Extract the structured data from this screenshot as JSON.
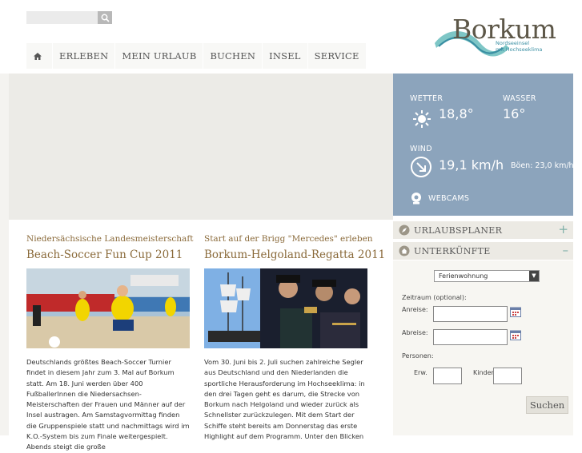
{
  "search": {
    "placeholder": ""
  },
  "nav": {
    "items": [
      {
        "label": "ERLEBEN"
      },
      {
        "label": "MEIN URLAUB"
      },
      {
        "label": "BUCHEN"
      },
      {
        "label": "INSEL"
      },
      {
        "label": "SERVICE"
      }
    ]
  },
  "logo": {
    "word": "Borkum",
    "sub1": "Nordseeinsel",
    "sub2": "mit Hochseeklima"
  },
  "weather": {
    "wetter_label": "WETTER",
    "wetter_value": "18,8°",
    "wasser_label": "WASSER",
    "wasser_value": "16°",
    "wind_label": "WIND",
    "wind_value": "19,1 km/h",
    "gusts": "Böen: 23,0 km/h",
    "webcams": "WEBCAMS"
  },
  "sidebar": {
    "urlaubsplaner": "URLAUBSPLANER",
    "unterkuenfte": "UNTERKÜNFTE",
    "type_select": "Ferienwohnung",
    "zeitraum": "Zeitraum (optional):",
    "anreise": "Anreise:",
    "abreise": "Abreise:",
    "personen": "Personen:",
    "erw": "Erw.",
    "kinder": "Kinder",
    "submit": "Suchen"
  },
  "articles": [
    {
      "overline": "Niedersächsische Landesmeisterschaft",
      "title": "Beach-Soccer Fun Cup 2011",
      "text": "Deutschlands größtes Beach-Soccer Turnier findet in diesem Jahr zum 3. Mal auf Borkum statt. Am 18. Juni werden über 400 FußballerInnen die Niedersachsen-Meisterschaften der Frauen und Männer auf der Insel austragen. Am Samstagvormittag finden die Gruppenspiele statt und nachmittags wird im K.O.-System bis zum Finale weitergespielt. Abends steigt die große"
    },
    {
      "overline": "Start auf der Brigg \"Mercedes\" erleben",
      "title": "Borkum-Helgoland-Regatta 2011",
      "text": "Vom 30. Juni bis 2. Juli suchen zahlreiche Segler aus Deutschland und den Niederlanden die sportliche Herausforderung im Hochseeklima: in den drei Tagen geht es darum, die Strecke von Borkum nach Helgoland und wieder zurück als Schnellster zurückzulegen. Mit dem Start der Schiffe steht bereits am Donnerstag das erste Highlight auf dem Programm. Unter den Blicken"
    }
  ],
  "colors": {
    "accent_brown": "#8a6a3a",
    "weather_bg": "#8ca4bc",
    "logo_teal": "#3a8fa3"
  }
}
